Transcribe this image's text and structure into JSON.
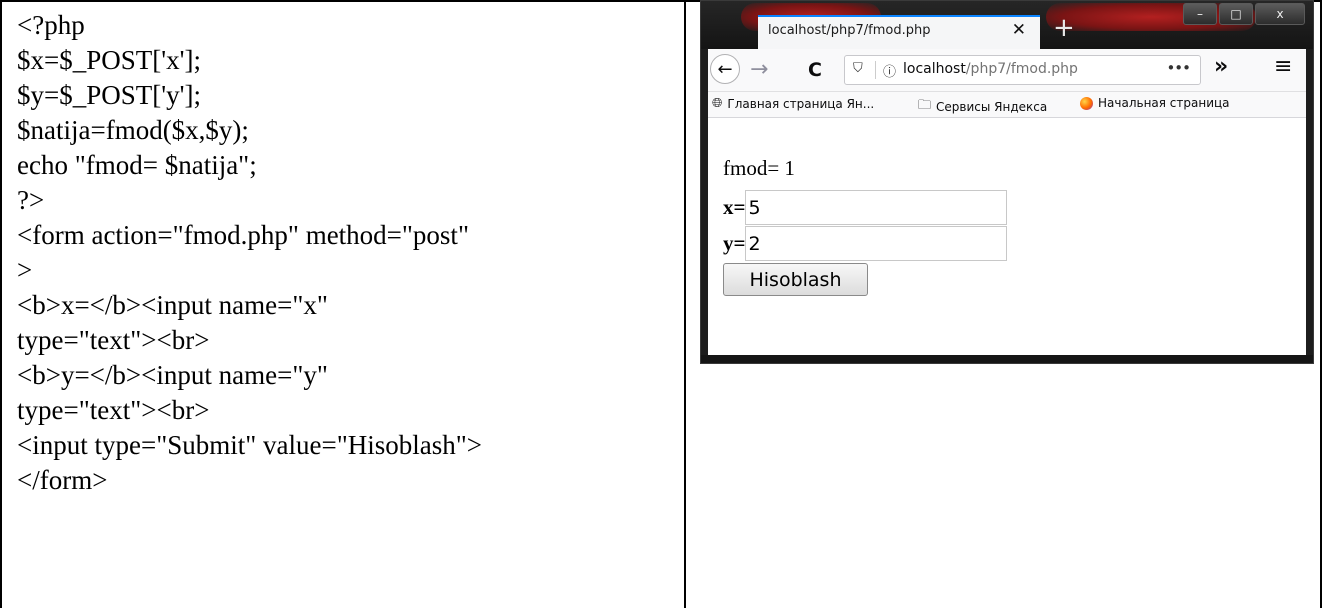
{
  "code": {
    "lines": [
      "<?php",
      "$x=$_POST['x'];",
      "$y=$_POST['y'];",
      "$natija=fmod($x,$y);",
      "echo \"fmod= $natija\";",
      "?>",
      "<form action=\"fmod.php\" method=\"post\"",
      ">",
      "<b>x=</b><input name=\"x\"",
      "type=\"text\"><br>",
      "<b>y=</b><input name=\"y\"",
      "type=\"text\"><br>",
      "<input type=\"Submit\" value=\"Hisoblash\">",
      "</form>"
    ]
  },
  "browser": {
    "tab": {
      "title": "localhost/php7/fmod.php",
      "close": "✕"
    },
    "new_tab": "+",
    "window_buttons": {
      "minimize": "–",
      "maximize": "□",
      "close": "x"
    },
    "nav": {
      "back": "←",
      "forward": "→",
      "reload": "C"
    },
    "url": {
      "host": "localhost",
      "path": "/php7/fmod.php",
      "more": "•••"
    },
    "overflow": "»",
    "menu": "≡",
    "bookmarks": [
      {
        "icon": "globe-icon",
        "label": "Главная страница Ян..."
      },
      {
        "icon": "folder-icon",
        "label": "Сервисы Яндекса"
      },
      {
        "icon": "firefox-icon",
        "label": "Начальная страница"
      }
    ]
  },
  "page": {
    "result": "fmod= 1",
    "x_label": "x=",
    "x_value": "5",
    "y_label": "y=",
    "y_value": "2",
    "submit_label": "Hisoblash"
  },
  "colors": {
    "tab_accent": "#0a84ff",
    "title_glow": "#b32020"
  }
}
